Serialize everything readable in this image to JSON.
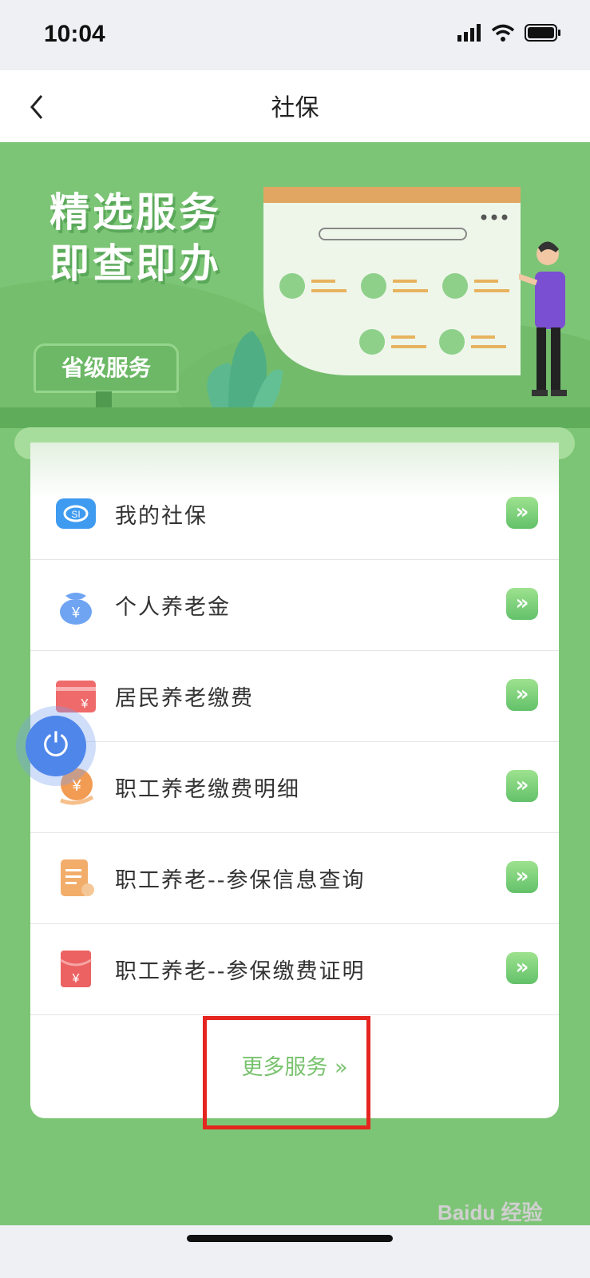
{
  "status_bar": {
    "time": "10:04"
  },
  "nav": {
    "title": "社保"
  },
  "banner": {
    "slogan_line1": "精选服务",
    "slogan_line2": "即查即办",
    "badge": "省级服务"
  },
  "services": [
    {
      "label": "我的社保",
      "icon": "social-security-icon",
      "color": "#3f9bf0"
    },
    {
      "label": "个人养老金",
      "icon": "money-bag-icon",
      "color": "#4f86ea"
    },
    {
      "label": "居民养老缴费",
      "icon": "payment-card-icon",
      "color": "#ef6a6a"
    },
    {
      "label": "职工养老缴费明细",
      "icon": "coin-hand-icon",
      "color": "#f29b53"
    },
    {
      "label": "职工养老--参保信息查询",
      "icon": "document-icon",
      "color": "#f2ad6a"
    },
    {
      "label": "职工养老--参保缴费证明",
      "icon": "red-envelope-icon",
      "color": "#ec6262"
    }
  ],
  "more_services": "更多服务 »",
  "watermark": "Baidu 经验"
}
